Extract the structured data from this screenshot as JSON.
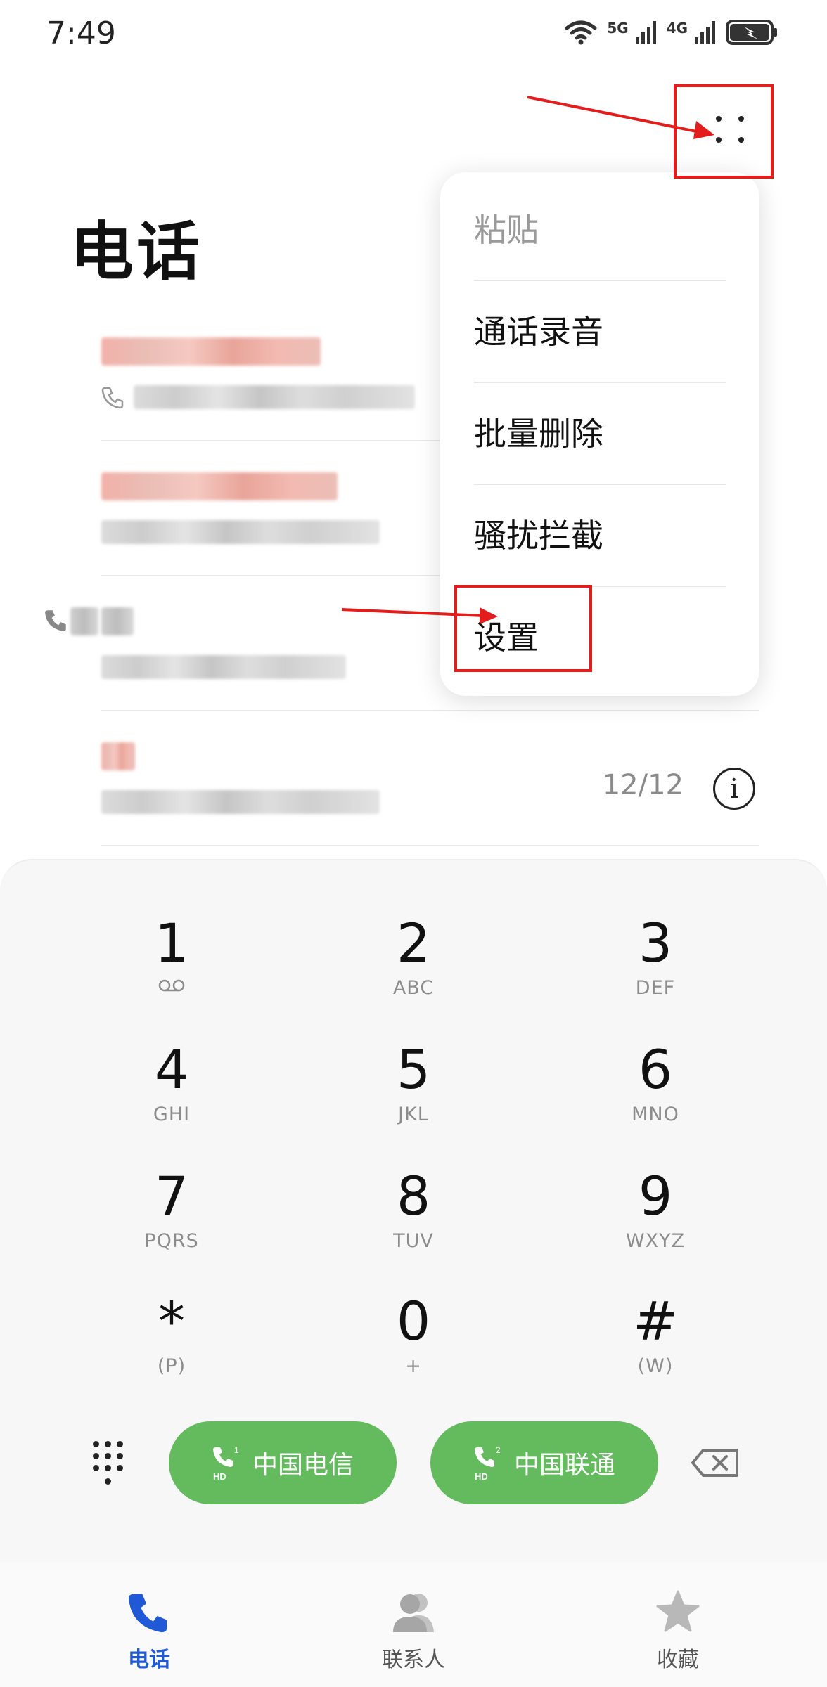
{
  "status_bar": {
    "time": "7:49",
    "signal_1_label": "5G",
    "signal_2_label": "4G"
  },
  "header": {
    "title": "电话"
  },
  "call_log": [
    {
      "date": "",
      "name_blurred": true
    },
    {
      "date": "",
      "name_blurred": true
    },
    {
      "date": "",
      "name_blurred": true
    },
    {
      "date": "12/12",
      "name_blurred": true
    }
  ],
  "menu": {
    "items": [
      {
        "label": "粘贴",
        "enabled": false
      },
      {
        "label": "通话录音",
        "enabled": true
      },
      {
        "label": "批量删除",
        "enabled": true
      },
      {
        "label": "骚扰拦截",
        "enabled": true
      },
      {
        "label": "设置",
        "enabled": true
      }
    ]
  },
  "dialpad": {
    "keys": [
      {
        "digit": "1",
        "letters": ""
      },
      {
        "digit": "2",
        "letters": "ABC"
      },
      {
        "digit": "3",
        "letters": "DEF"
      },
      {
        "digit": "4",
        "letters": "GHI"
      },
      {
        "digit": "5",
        "letters": "JKL"
      },
      {
        "digit": "6",
        "letters": "MNO"
      },
      {
        "digit": "7",
        "letters": "PQRS"
      },
      {
        "digit": "8",
        "letters": "TUV"
      },
      {
        "digit": "9",
        "letters": "WXYZ"
      },
      {
        "digit": "*",
        "letters": "(P)"
      },
      {
        "digit": "0",
        "letters": "+"
      },
      {
        "digit": "#",
        "letters": "(W)"
      }
    ],
    "sim1_label": "中国电信",
    "sim2_label": "中国联通",
    "sim1_badge": "1",
    "sim2_badge": "2",
    "hd_badge": "HD"
  },
  "tabs": [
    {
      "label": "电话",
      "active": true
    },
    {
      "label": "联系人",
      "active": false
    },
    {
      "label": "收藏",
      "active": false
    }
  ],
  "colors": {
    "call_button": "#63bb5e",
    "active_tab": "#2059d6",
    "annotation": "#e31c1c"
  },
  "icons": {
    "more": "more-dots-icon",
    "info": "info-icon",
    "voicemail": "voicemail-icon",
    "backspace": "backspace-icon",
    "phone": "phone-icon",
    "contacts": "contacts-icon",
    "favorites": "star-icon"
  }
}
